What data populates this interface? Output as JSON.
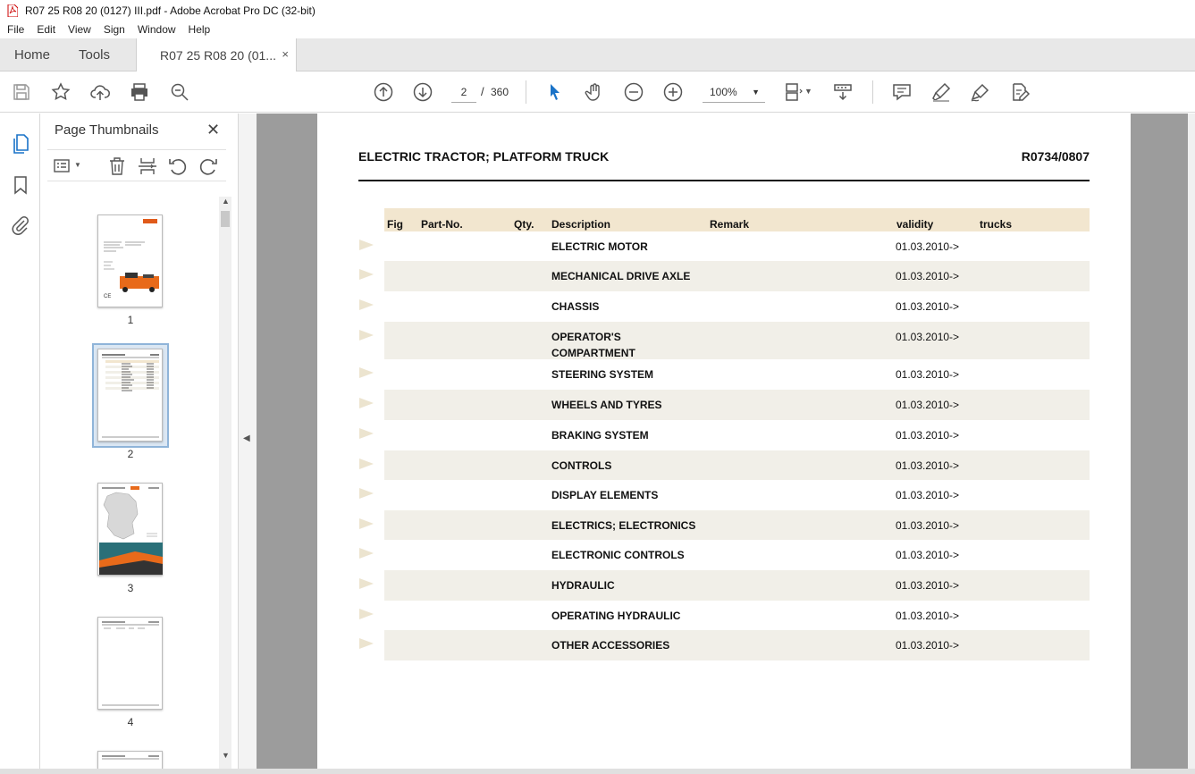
{
  "window": {
    "title": "R07 25 R08 20 (0127) III.pdf - Adobe Acrobat Pro DC (32-bit)"
  },
  "menu": [
    "File",
    "Edit",
    "View",
    "Sign",
    "Window",
    "Help"
  ],
  "tabs": {
    "home": "Home",
    "tools": "Tools",
    "doc": "R07 25 R08 20 (01...",
    "close": "×"
  },
  "toolbar": {
    "page_current": "2",
    "page_sep": "/",
    "page_total": "360",
    "zoom": "100%"
  },
  "thumbnails": {
    "title": "Page Thumbnails",
    "close": "✕",
    "pages": [
      "1",
      "2",
      "3",
      "4"
    ]
  },
  "document": {
    "title": "ELECTRIC TRACTOR; PLATFORM TRUCK",
    "code": "R0734/0807",
    "columns": [
      "Fig",
      "Part-No.",
      "Qty.",
      "Description",
      "Remark",
      "validity",
      "trucks"
    ],
    "rows": [
      {
        "description": "ELECTRIC MOTOR",
        "validity": "01.03.2010->"
      },
      {
        "description": "MECHANICAL DRIVE AXLE",
        "validity": "01.03.2010->"
      },
      {
        "description": "CHASSIS",
        "validity": "01.03.2010->"
      },
      {
        "description": "OPERATOR'S",
        "description2": "COMPARTMENT",
        "validity": "01.03.2010->"
      },
      {
        "description": "STEERING SYSTEM",
        "validity": "01.03.2010->"
      },
      {
        "description": "WHEELS AND TYRES",
        "validity": "01.03.2010->"
      },
      {
        "description": "BRAKING SYSTEM",
        "validity": "01.03.2010->"
      },
      {
        "description": "CONTROLS",
        "validity": "01.03.2010->"
      },
      {
        "description": "DISPLAY ELEMENTS",
        "validity": "01.03.2010->"
      },
      {
        "description": "ELECTRICS; ELECTRONICS",
        "validity": "01.03.2010->"
      },
      {
        "description": "ELECTRONIC CONTROLS",
        "validity": "01.03.2010->"
      },
      {
        "description": "HYDRAULIC",
        "validity": "01.03.2010->"
      },
      {
        "description": "OPERATING HYDRAULIC",
        "validity": "01.03.2010->"
      },
      {
        "description": "OTHER ACCESSORIES",
        "validity": "01.03.2010->"
      }
    ]
  },
  "colors": {
    "accent": "#1a73c8",
    "header_bg": "#f2e6cf",
    "row_alt": "#f1efe8",
    "doc_bg": "#9c9c9c"
  },
  "icons": [
    "save-icon",
    "bookmark-star-icon",
    "upload-icon",
    "print-icon",
    "search-zoom-icon",
    "page-up-icon",
    "page-down-icon",
    "select-arrow-icon",
    "hand-icon",
    "zoom-out-icon",
    "zoom-in-icon",
    "fit-page-icon",
    "scroll-mode-icon",
    "comment-icon",
    "highlight-icon",
    "sign-icon",
    "edit-pdf-icon"
  ]
}
